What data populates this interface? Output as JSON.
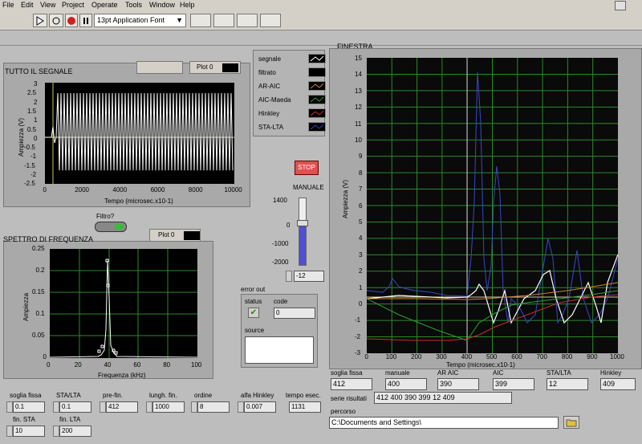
{
  "menu": [
    "File",
    "Edit",
    "View",
    "Project",
    "Operate",
    "Tools",
    "Window",
    "Help"
  ],
  "toolbar": {
    "font_select": "13pt Application Font"
  },
  "signal_plot": {
    "title": "TUTTO IL SEGNALE",
    "plot_label": "Plot 0",
    "ylabel": "Ampiezza (V)",
    "xlabel": "Tempo (microsec.x10-1)",
    "yticks": [
      "3",
      "2.5",
      "2",
      "1.5",
      "1",
      "0.5",
      "0",
      "-0.5",
      "-1",
      "-1.5",
      "-2",
      "-2.5"
    ],
    "xticks": [
      "0",
      "2000",
      "4000",
      "6000",
      "8000",
      "10000"
    ]
  },
  "legend": {
    "items": [
      {
        "name": "segnale",
        "color": "#ffffff"
      },
      {
        "name": "filtrato",
        "color": "#000000"
      },
      {
        "name": "AR-AIC",
        "color": "#d08030"
      },
      {
        "name": "AIC-Maeda",
        "color": "#30a030"
      },
      {
        "name": "Hinkley",
        "color": "#c03030"
      },
      {
        "name": "STA-LTA",
        "color": "#3040c0"
      }
    ]
  },
  "stop_label": "STOP",
  "manuale": {
    "title": "MANUALE",
    "ticks": [
      "1400",
      "0",
      "-1000",
      "-2000"
    ],
    "value": "-12"
  },
  "filtro": {
    "label": "Filtro?"
  },
  "spectrum": {
    "title": "SPETTRO DI FREQUENZA",
    "plot_label": "Plot 0",
    "ylabel": "Ampiezza",
    "xlabel": "Frequenza (kHz)",
    "yticks": [
      "0.25",
      "0.2",
      "0.15",
      "0.1",
      "0.05",
      "0"
    ],
    "xticks": [
      "0",
      "20",
      "40",
      "60",
      "80",
      "100"
    ]
  },
  "error_out": {
    "title": "error out",
    "status_label": "status",
    "code_label": "code",
    "code_value": "0",
    "source_label": "source"
  },
  "finestra": {
    "title": "FINESTRA",
    "ylabel": "Ampiezza (V)",
    "xlabel": "Tempo (microsec.x10-1)",
    "yticks": [
      "15",
      "14",
      "13",
      "12",
      "11",
      "10",
      "9",
      "8",
      "7",
      "6",
      "5",
      "4",
      "3",
      "2",
      "1",
      "0",
      "-1",
      "-2",
      "-3"
    ],
    "xticks": [
      "0",
      "100",
      "200",
      "300",
      "400",
      "500",
      "600",
      "700",
      "800",
      "900",
      "1000"
    ]
  },
  "results": [
    {
      "label": "soglia fissa",
      "value": "412"
    },
    {
      "label": "manuale",
      "value": "400"
    },
    {
      "label": "AR AIC",
      "value": "390"
    },
    {
      "label": "AIC",
      "value": "399"
    },
    {
      "label": "STA/LTA",
      "value": "12"
    },
    {
      "label": "Hinkley",
      "value": "409"
    }
  ],
  "serie_risultati": {
    "label": "serie risultati",
    "value": "412   400   390   399   12   409"
  },
  "percorso": {
    "label": "percorso",
    "value": "C:\\Documents and Settings\\"
  },
  "params": [
    {
      "label": "soglia fissa",
      "value": "0.1"
    },
    {
      "label": "STA/LTA",
      "value": "0.1"
    },
    {
      "label": "pre-fin.",
      "value": "412"
    },
    {
      "label": "lungh. fin.",
      "value": "1000"
    },
    {
      "label": "ordine",
      "value": "8"
    },
    {
      "label": "alfa  Hinkley",
      "value": "0.007"
    },
    {
      "label": "tempo esec.",
      "value": "1131"
    }
  ],
  "params2": [
    {
      "label": "fin. STA",
      "value": "10"
    },
    {
      "label": "fin. LTA",
      "value": "200"
    }
  ]
}
